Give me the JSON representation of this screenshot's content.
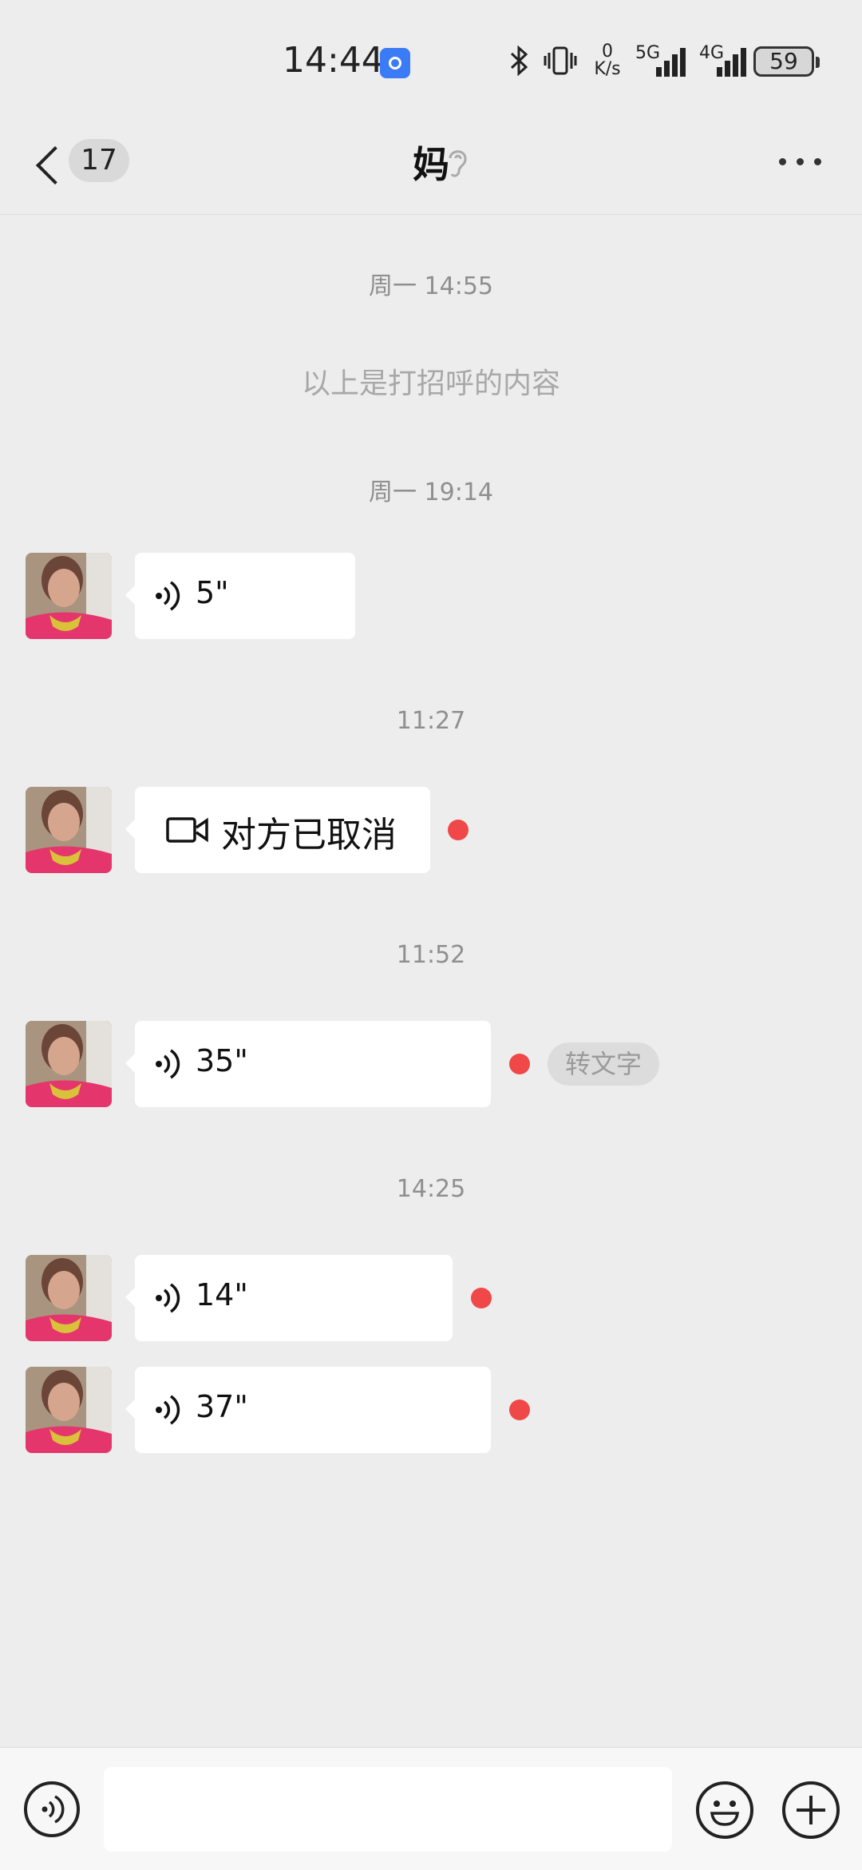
{
  "status_bar": {
    "time": "14:44",
    "speed_value": "0",
    "speed_unit": "K/s",
    "net1": "5G",
    "net2": "4G",
    "battery": "59"
  },
  "header": {
    "unread_count": "17",
    "title": "妈",
    "icons": [
      "back-arrow-icon",
      "ear-icon",
      "more-icon"
    ]
  },
  "chat": {
    "timestamps": [
      "周一 14:55",
      "周一 19:14",
      "11:27",
      "11:52",
      "14:25"
    ],
    "system_notice": "以上是打招呼的内容",
    "messages": [
      {
        "type": "voice",
        "duration": "5\"",
        "unread": false
      },
      {
        "type": "video_call",
        "text": "对方已取消",
        "unread": true
      },
      {
        "type": "voice",
        "duration": "35\"",
        "unread": true,
        "action": "转文字"
      },
      {
        "type": "voice",
        "duration": "14\"",
        "unread": true
      },
      {
        "type": "voice",
        "duration": "37\"",
        "unread": true
      }
    ]
  },
  "input_bar": {
    "text_value": "",
    "icons": [
      "voice-mode-icon",
      "emoji-icon",
      "plus-icon"
    ]
  },
  "colors": {
    "background": "#ededed",
    "unread_dot": "#f04848",
    "bubble": "#ffffff"
  }
}
